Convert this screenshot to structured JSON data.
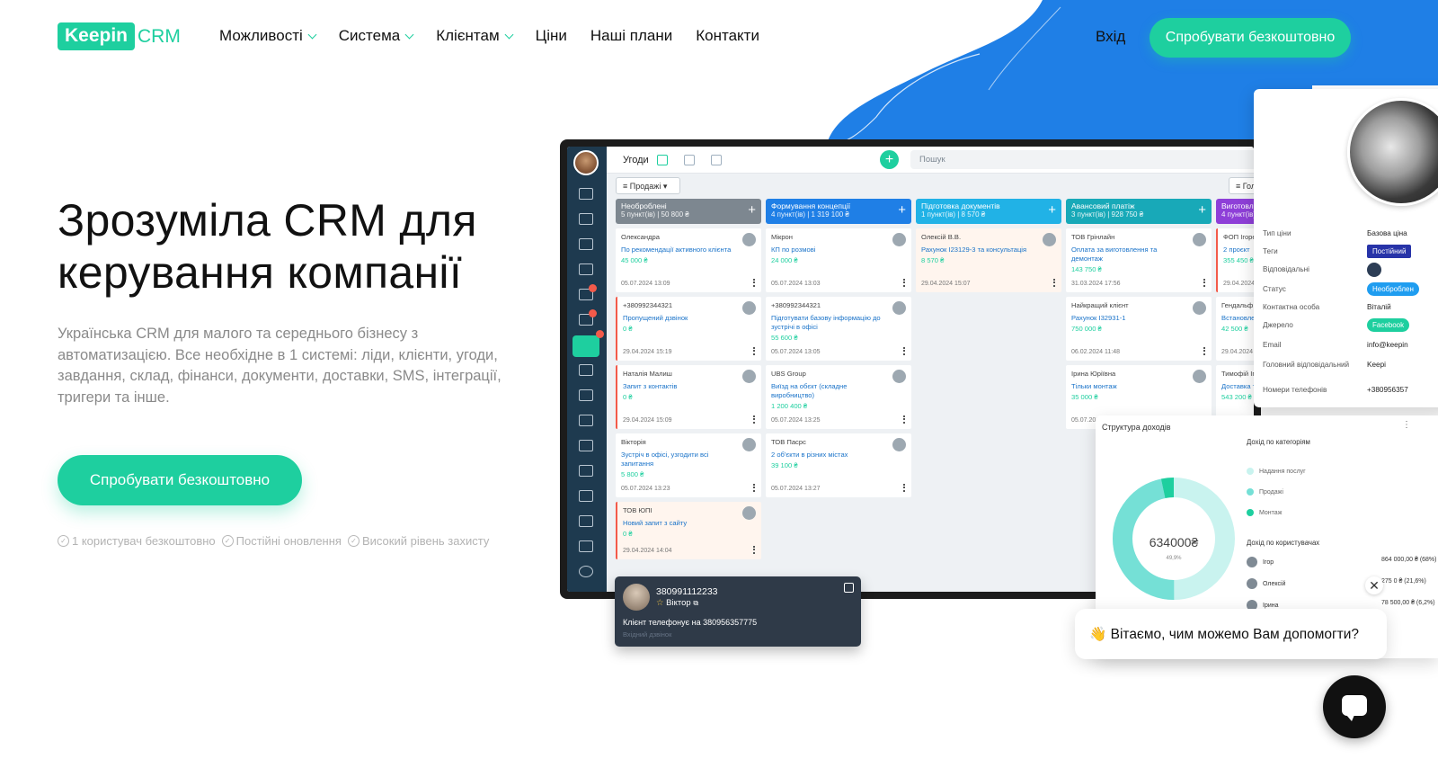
{
  "brand": {
    "logo_main": "Keepin",
    "logo_sub": "CRM",
    "accent": "#1ecf9f",
    "blue": "#1f7fe6"
  },
  "nav": {
    "items": [
      {
        "label": "Можливості",
        "dropdown": true
      },
      {
        "label": "Система",
        "dropdown": true
      },
      {
        "label": "Клієнтам",
        "dropdown": true
      },
      {
        "label": "Ціни",
        "dropdown": false
      },
      {
        "label": "Наші плани",
        "dropdown": false
      },
      {
        "label": "Контакти",
        "dropdown": false
      }
    ],
    "login": "Вхід",
    "cta": "Спробувати безкоштовно"
  },
  "hero": {
    "title": "Зрозуміла CRM для керування компанії",
    "lead": "Українська CRM для малого та середнього бізнесу з автоматизацією. Все необхідне в 1 системі: ліди, клієнти, угоди, завдання, склад, фінанси, документи, доставки, SMS, інтеграції, тригери та інше.",
    "cta": "Спробувати безкоштовно",
    "perks": [
      "1 користувач безкоштовно",
      "Постійні оновлення",
      "Високий рівень захисту"
    ]
  },
  "app": {
    "title": "Угоди",
    "search_placeholder": "Пошук",
    "filter": "Продажі",
    "filter2": "Голо",
    "columns": [
      {
        "name": "Необроблені",
        "summary": "5 пункт(ів) | 50 800 ₴",
        "color": "#7d8790",
        "cards": [
          {
            "who": "Олександра",
            "link": "По рекомендації активного клієнта",
            "amount": "45 000 ₴",
            "date": "05.07.2024 13:09",
            "style": ""
          },
          {
            "who": "+380992344321",
            "link": "Пропущений дзвінок",
            "amount": "0 ₴",
            "date": "29.04.2024 15:19",
            "style": "red"
          },
          {
            "who": "Наталія Малиш",
            "link": "Запит з контактів",
            "amount": "0 ₴",
            "date": "29.04.2024 15:09",
            "style": "red"
          },
          {
            "who": "Вікторія",
            "link": "Зустріч в офісі, узгодити всі запитання",
            "amount": "5 800 ₴",
            "date": "05.07.2024 13:23",
            "style": ""
          },
          {
            "who": "ТОВ ЮПІ",
            "link": "Новий запит з сайту",
            "amount": "0 ₴",
            "date": "29.04.2024 14:04",
            "style": "red pink"
          }
        ]
      },
      {
        "name": "Формування концепції",
        "summary": "4 пункт(ів) | 1 319 100 ₴",
        "color": "#1f7fe6",
        "cards": [
          {
            "who": "Мікрон",
            "link": "КП по розмові",
            "amount": "24 000 ₴",
            "date": "05.07.2024 13:03",
            "style": ""
          },
          {
            "who": "+380992344321",
            "link": "Підготувати базову інформацію до зустрічі в офісі",
            "amount": "55 600 ₴",
            "date": "05.07.2024 13:05",
            "style": ""
          },
          {
            "who": "UBS Group",
            "link": "Виїзд на обєкт (складне виробництво)",
            "amount": "1 200 400 ₴",
            "date": "05.07.2024 13:25",
            "style": ""
          },
          {
            "who": "ТОВ Пасрс",
            "link": "2 об'єкти в різних містах",
            "amount": "39 100 ₴",
            "date": "05.07.2024 13:27",
            "style": ""
          }
        ]
      },
      {
        "name": "Підготовка документів",
        "summary": "1 пункт(ів) | 8 570 ₴",
        "color": "#21b2e6",
        "cards": [
          {
            "who": "Олексій В.В.",
            "link": "Рахунок I23129-3 та консультація",
            "amount": "8 570 ₴",
            "date": "29.04.2024 15:07",
            "style": "pink"
          }
        ]
      },
      {
        "name": "Авансовий платіж",
        "summary": "3 пункт(ів) | 928 750 ₴",
        "color": "#18a9b8",
        "cards": [
          {
            "who": "ТОВ Грінлайн",
            "link": "Оплата за виготовлення та демонтаж",
            "amount": "143 750 ₴",
            "date": "31.03.2024 17:56",
            "style": ""
          },
          {
            "who": "Найкращий клієнт",
            "link": "Рахунок I32931-1",
            "amount": "750 000 ₴",
            "date": "06.02.2024 11:48",
            "style": ""
          },
          {
            "who": "Ірина Юріївна",
            "link": "Тільки монтаж",
            "amount": "35 000 ₴",
            "date": "05.07.2024",
            "style": ""
          }
        ]
      },
      {
        "name": "Виготовлен",
        "summary": "4 пункт(ів)",
        "color": "#8e3fd8",
        "cards": [
          {
            "who": "ФОП Ігорен",
            "link": "2 проєкт",
            "amount": "355 450 ₴",
            "date": "29.04.2024",
            "style": "red"
          },
          {
            "who": "Гендальф Бі",
            "link": "Встановлен документац",
            "amount": "42 500 ₴",
            "date": "29.04.2024",
            "style": ""
          },
          {
            "who": "Тимофій Ігорев",
            "link": "Доставка та",
            "amount": "543 200 ₴",
            "date": "",
            "style": ""
          }
        ]
      }
    ]
  },
  "call": {
    "number": "380991112233",
    "name": "Віктор",
    "text": "Клієнт телефонує на 380956357775",
    "status": "Вхідний дзвінок"
  },
  "profile": {
    "rows": [
      {
        "label": "Тип ціни",
        "value": "Базова ціна",
        "pill": ""
      },
      {
        "label": "Теги",
        "value": "Постійний",
        "pill": "#2733a8"
      },
      {
        "label": "Відповідальні",
        "value": "",
        "pill": ""
      },
      {
        "label": "Статус",
        "value": "Необроблен",
        "pill": "#1f9df0"
      },
      {
        "label": "Контактна особа",
        "value": "Віталій",
        "pill": ""
      },
      {
        "label": "Джерело",
        "value": "Facebook",
        "pill": "#1ecf9f"
      },
      {
        "label": "Email",
        "value": "info@keepin",
        "pill": ""
      },
      {
        "label": "Головний відповідальний",
        "value": "Keepi",
        "pill": ""
      },
      {
        "label": "Номери телефонів",
        "value": "+380956357",
        "pill": ""
      }
    ]
  },
  "income": {
    "title": "Структура доходів",
    "by_category_title": "Дохід по категоріям",
    "by_user_title": "Дохід по користувачах",
    "total_label": "634000₴",
    "pct_label": "49,9%",
    "categories": [
      {
        "name": "Надання послуг",
        "value": "634000",
        "color": "#c9f3ef"
      },
      {
        "name": "Продажі",
        "value": "594000",
        "color": "#75e0d6"
      },
      {
        "name": "Монтаж",
        "value": "43500",
        "color": "#1ecf9f"
      }
    ],
    "users": [
      {
        "name": "Ігор",
        "value": "864 000,00 ₴ (68%)"
      },
      {
        "name": "Олексій",
        "value": "275 0  ₴ (21,6%)"
      },
      {
        "name": "Ірина",
        "value": "78 500,00 ₴ (6,2%)"
      }
    ]
  },
  "chat": {
    "greeting": "👋 Вітаємо, чим можемо Вам допомогти?",
    "close": "✕"
  }
}
